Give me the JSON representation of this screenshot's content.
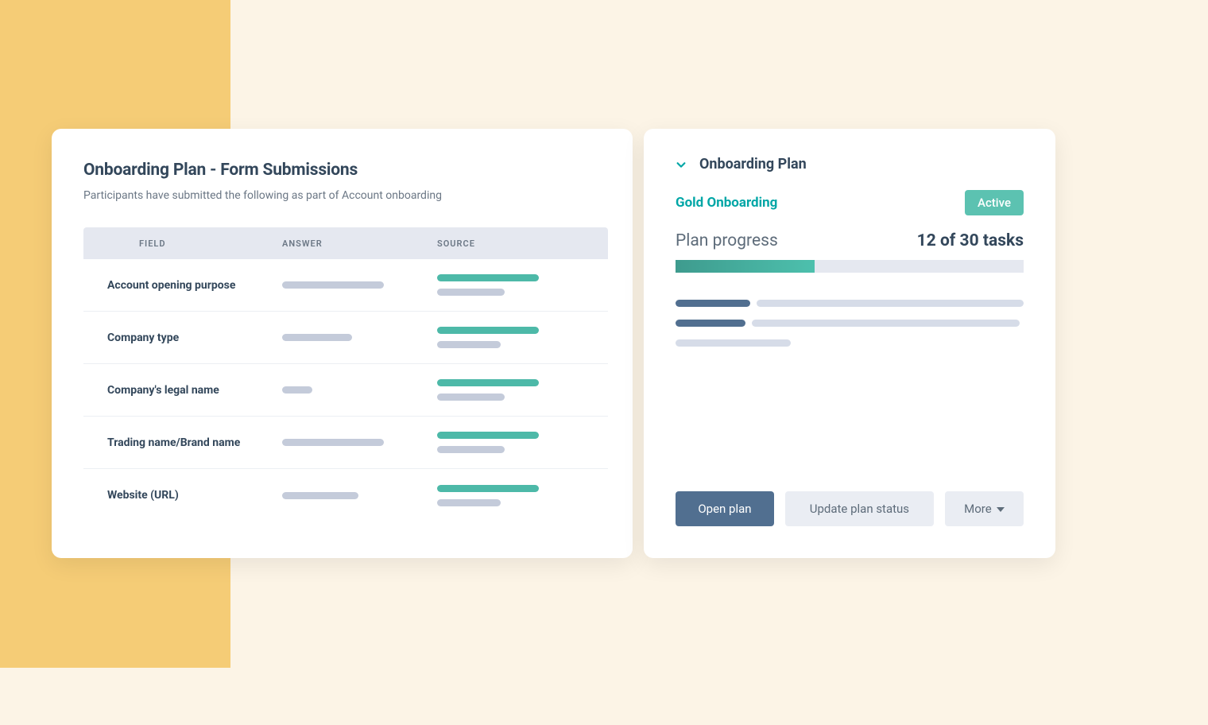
{
  "left": {
    "title": "Onboarding Plan - Form Submissions",
    "subtitle": "Participants have submitted the following as part of Account onboarding",
    "columns": {
      "field": "FIELD",
      "answer": "ANSWER",
      "source": "SOURCE"
    },
    "rows": [
      {
        "field": "Account opening purpose",
        "answer_w": 128,
        "src_top_w": 128,
        "src_bot_w": 85
      },
      {
        "field": "Company type",
        "answer_w": 88,
        "src_top_w": 128,
        "src_bot_w": 80
      },
      {
        "field": "Company's legal name",
        "answer_w": 38,
        "src_top_w": 128,
        "src_bot_w": 85
      },
      {
        "field": "Trading name/Brand name",
        "answer_w": 128,
        "src_top_w": 128,
        "src_bot_w": 85
      },
      {
        "field": "Website (URL)",
        "answer_w": 96,
        "src_top_w": 128,
        "src_bot_w": 80
      }
    ]
  },
  "right": {
    "section_title": "Onboarding Plan",
    "plan_name": "Gold Onboarding",
    "status_badge": "Active",
    "progress_label": "Plan progress",
    "progress_count": "12 of 30 tasks",
    "progress_pct": 40,
    "buttons": {
      "open": "Open plan",
      "update": "Update plan status",
      "more": "More"
    },
    "icons": {
      "chevron": "chevron-down-icon",
      "caret": "caret-down-icon"
    },
    "colors": {
      "accent_teal": "#4DB9A8",
      "brand_slate": "#516F90",
      "text_dark": "#33475B"
    }
  }
}
